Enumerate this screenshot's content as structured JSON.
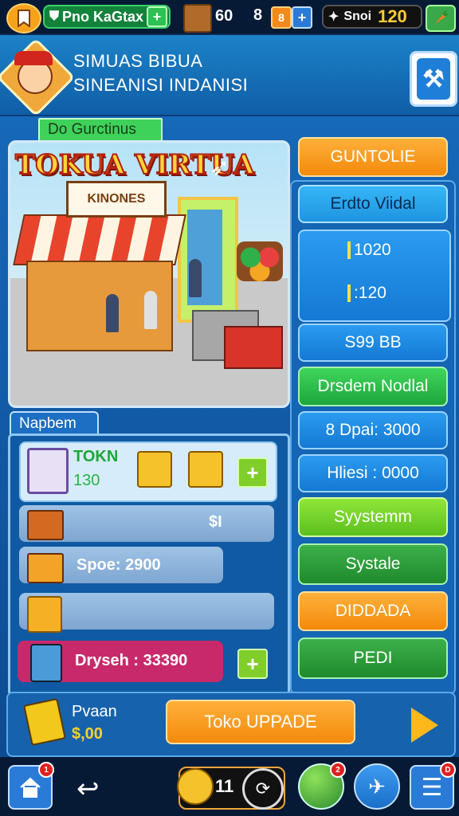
{
  "topbar": {
    "profile_name": "Pno KaGtax",
    "crate_count": "60",
    "b_label": "8",
    "currency_label": "Snoi",
    "currency_value": "120",
    "plus": "+"
  },
  "header": {
    "title_line1": "SIMUAS BIBUA",
    "title_line2": "SINEANISI INDANISI"
  },
  "scene": {
    "tag": "Do Gurctinus",
    "game_title": "TOKUA VIRTUA",
    "shop_sign": "KINONES"
  },
  "inventory": {
    "label": "Napbem",
    "token_label": "TOKN",
    "token_value": "130",
    "row2_value": "$I",
    "row3_value": "Spoe: 2900",
    "row5_value": "Dryseh : 33390",
    "plus": "+"
  },
  "right_column": {
    "continue": "GUNTOLIE",
    "mode": "Erdto Viidal",
    "stat1": "1020",
    "stat2": ":120",
    "score": "S99 BB",
    "system_model": "Drsdem Nodlal",
    "dpai": "8 Dpai: 3000",
    "hiesi": "Hliesi : 0000",
    "system": "Syystemm",
    "systale": "Systale",
    "dida": "DIDDADA",
    "pedi": "PEDI"
  },
  "upgrade": {
    "wallet_label": "Pvaan",
    "wallet_value": "$,00",
    "button": "Toko UPPADE"
  },
  "nav": {
    "home_badge": "1",
    "center_num": "11",
    "globe_badge": "2",
    "menu_badge": "D"
  },
  "colors": {
    "accent_orange": "#f38a0c",
    "accent_blue": "#1479d4",
    "accent_green": "#1fa63c",
    "accent_pink": "#c8296b"
  }
}
